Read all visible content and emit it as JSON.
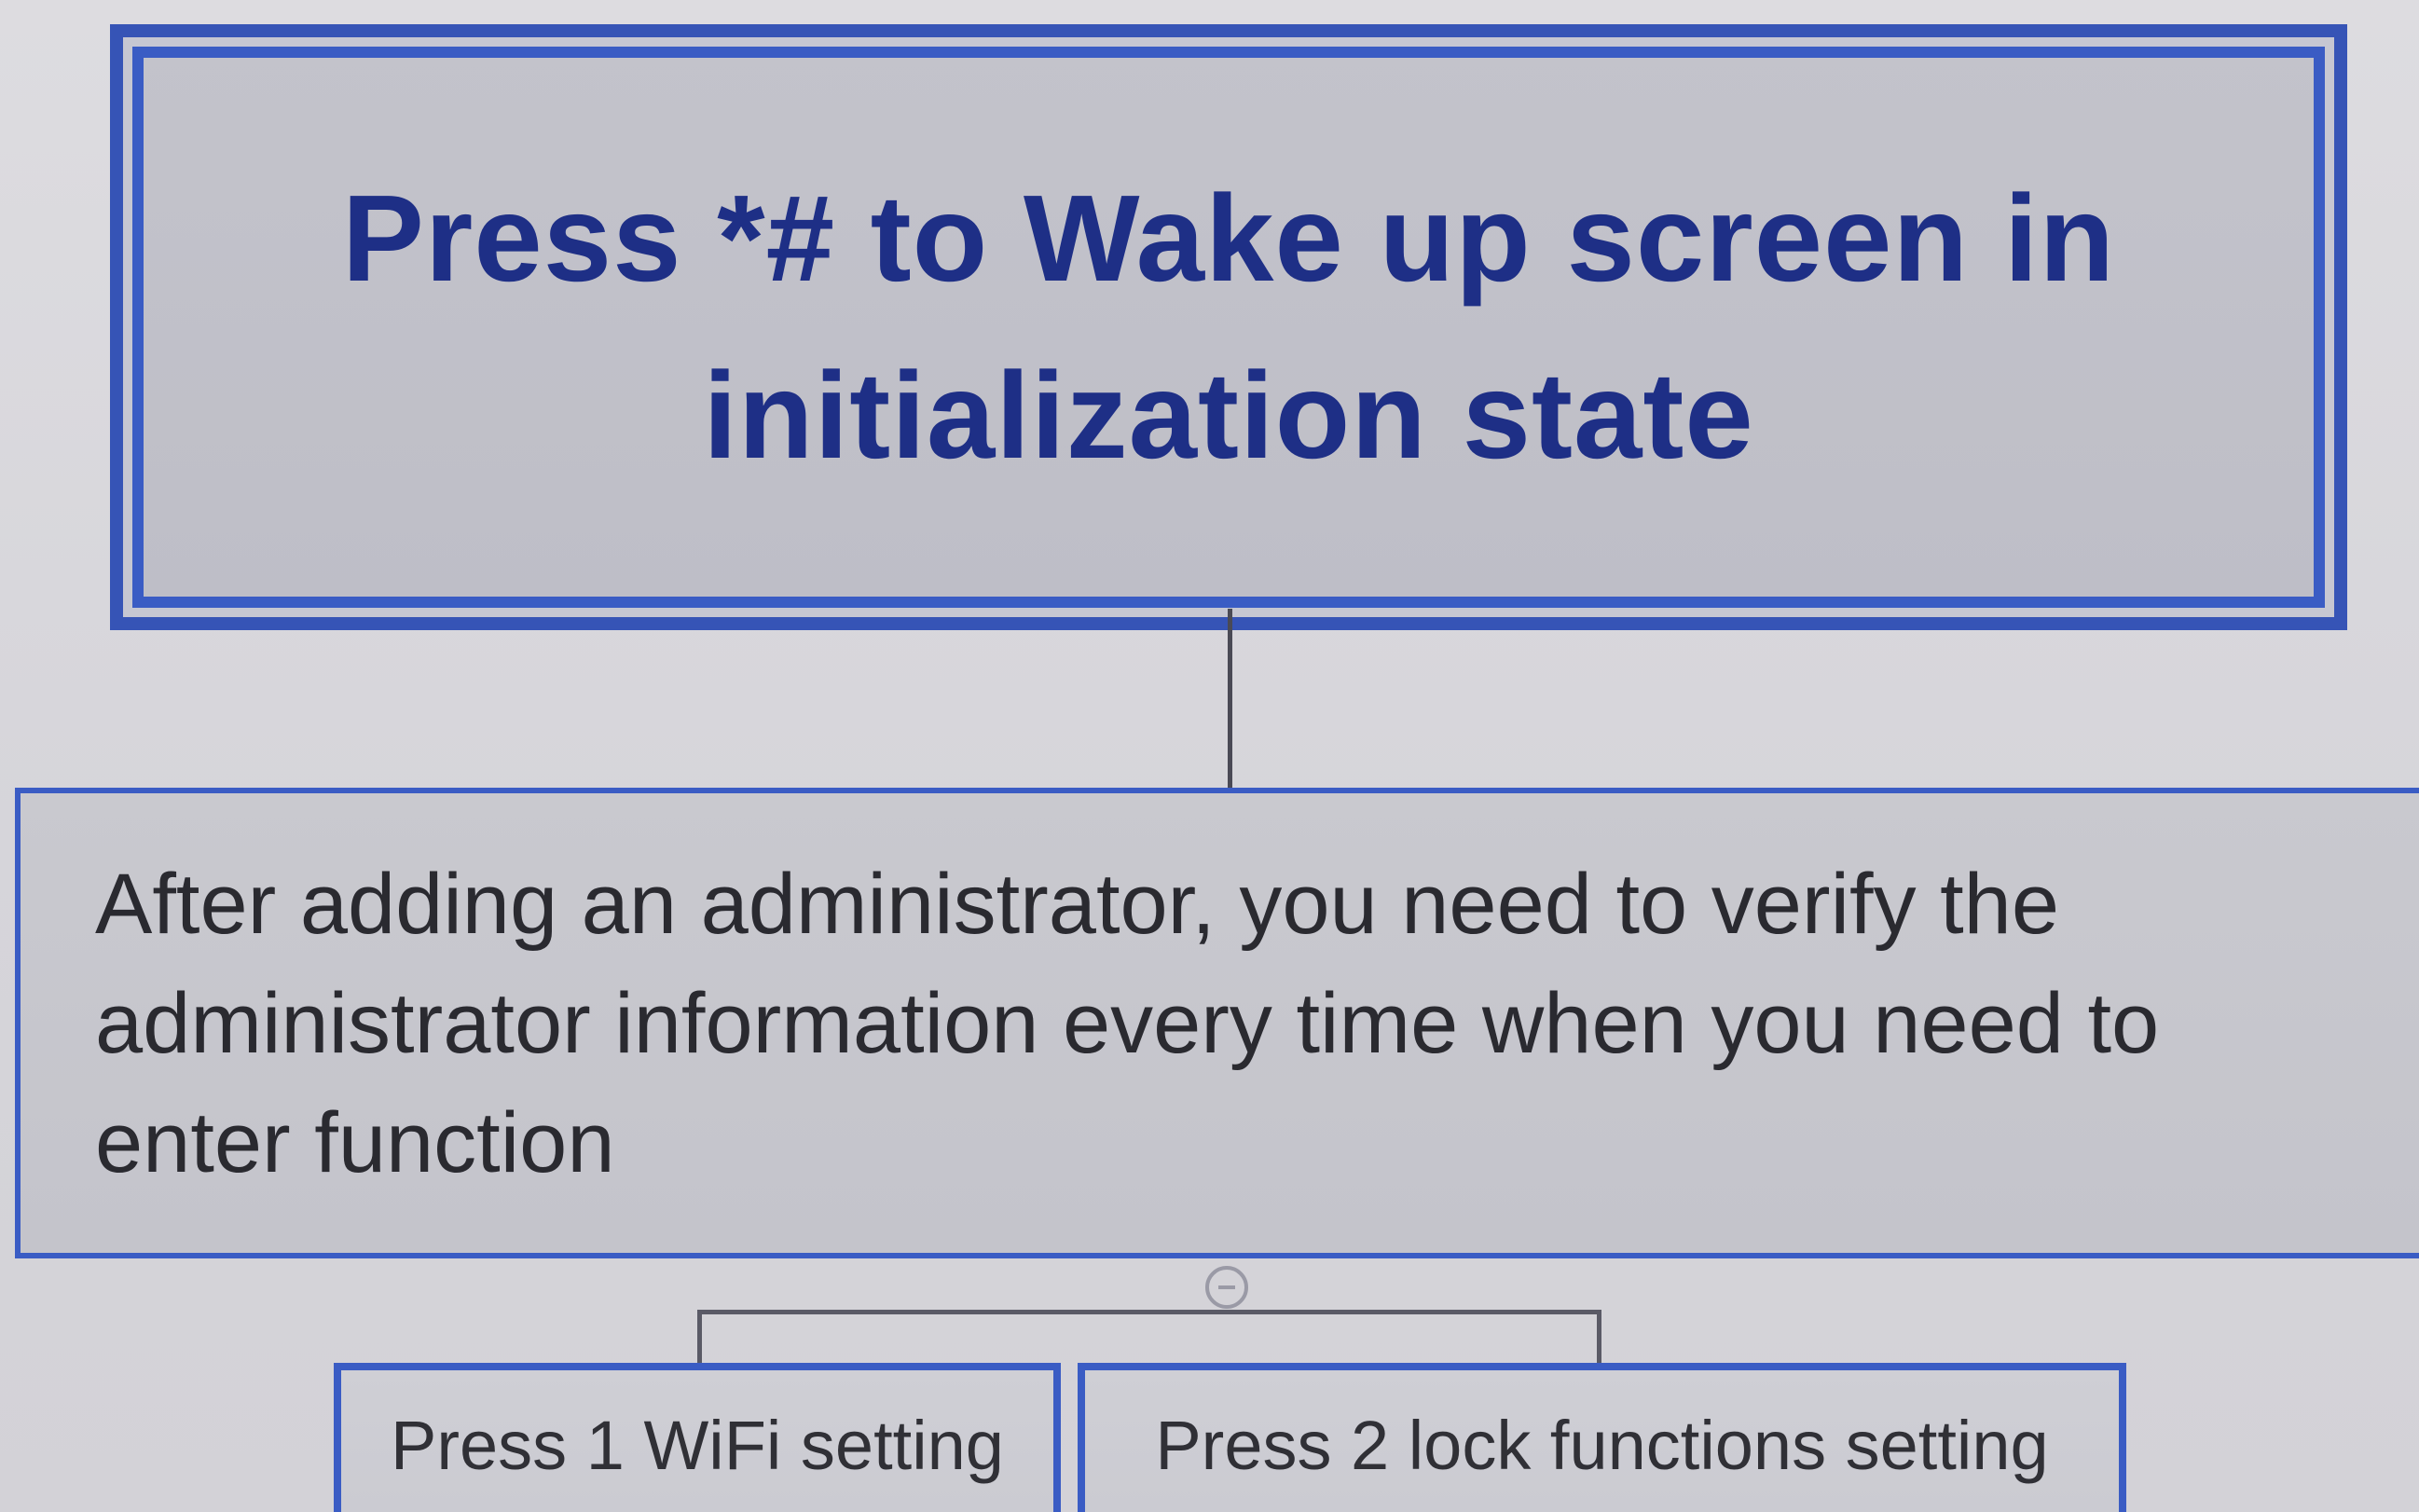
{
  "diagram": {
    "title_box": {
      "text": "Press *# to Wake up screen in initialization state"
    },
    "info_box": {
      "text": "After adding an administrator, you need to verify the administrator information every time when you need to enter function"
    },
    "options": [
      {
        "label": "Press 1 WiFi setting"
      },
      {
        "label": "Press 2 lock functions setting"
      }
    ],
    "colors": {
      "border": "#3a5cc4",
      "title_text": "#1e2f86",
      "body_text": "#2a2a30",
      "box_fill": "#c6c6cd",
      "background": "#d9d8dc"
    }
  }
}
